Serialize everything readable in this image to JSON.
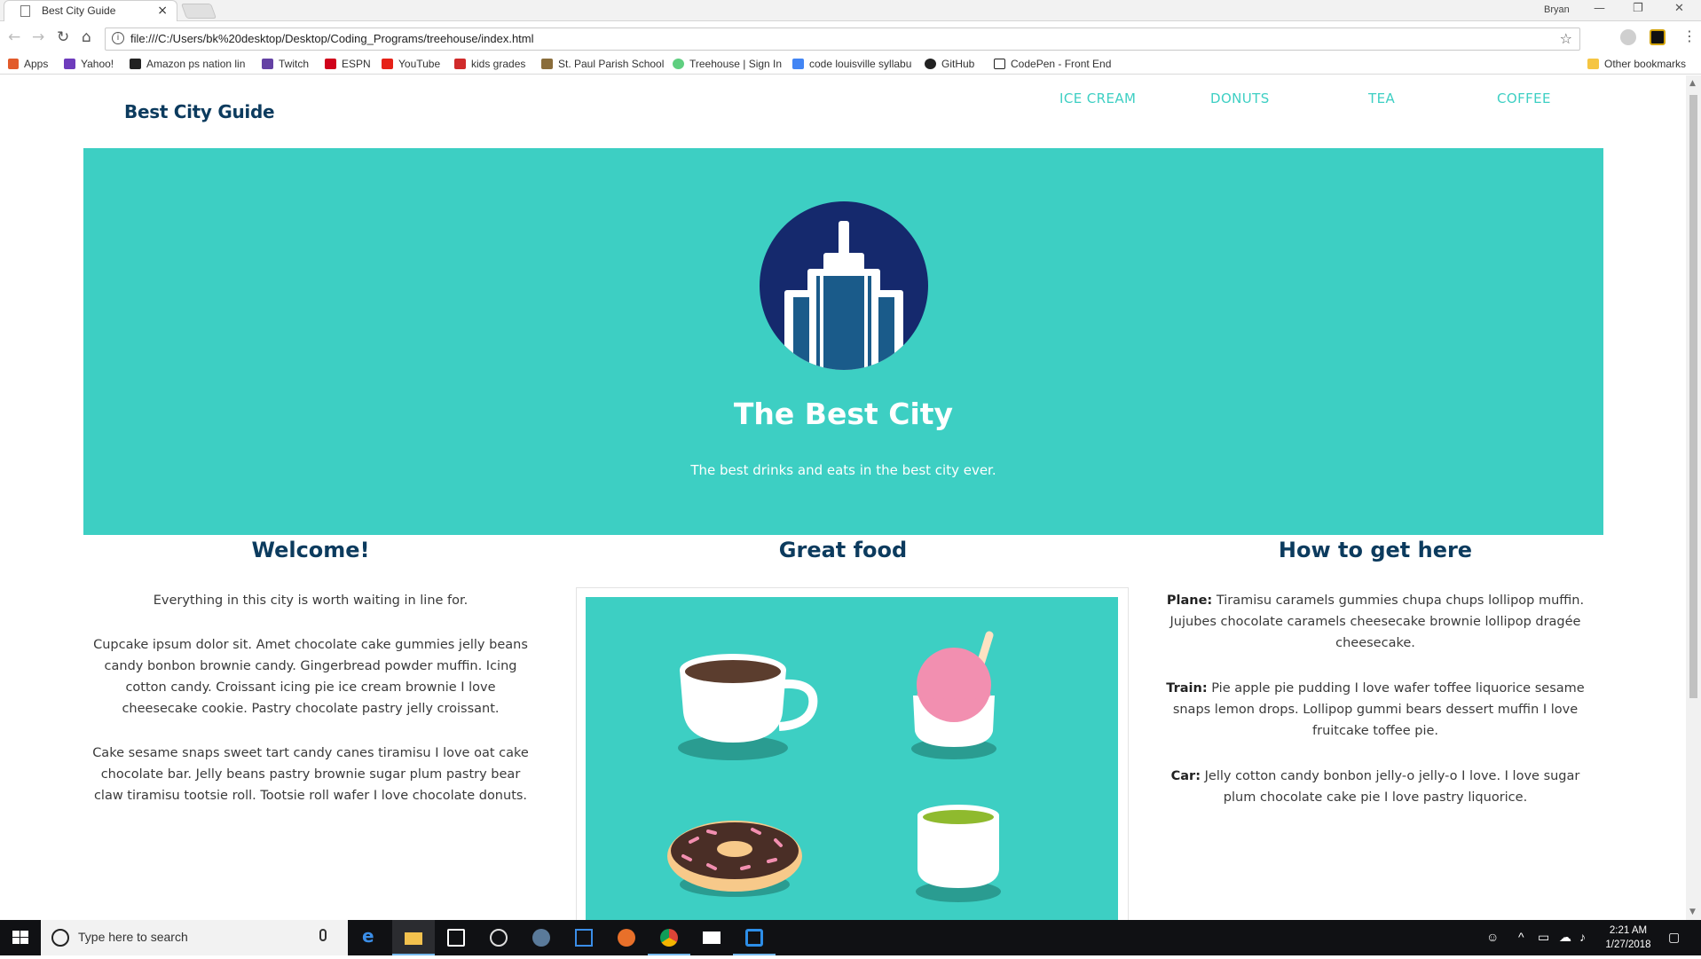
{
  "browser": {
    "tab_title": "Best City Guide",
    "tab_close": "×",
    "user_name": "Bryan",
    "window_controls": {
      "minimize": "—",
      "restore": "❐",
      "close": "✕"
    },
    "url": "file:///C:/Users/bk%20desktop/Desktop/Coding_Programs/treehouse/index.html",
    "bookmarks": [
      {
        "label": "Apps",
        "icon": "apps-grid-icon",
        "color": "#e25b2b"
      },
      {
        "label": "Yahoo!",
        "icon": "yahoo-icon",
        "color": "#6e3cbc"
      },
      {
        "label": "Amazon ps nation lin",
        "icon": "amazon-icon",
        "color": "#222222"
      },
      {
        "label": "Twitch",
        "icon": "twitch-icon",
        "color": "#6441a4"
      },
      {
        "label": "ESPN",
        "icon": "espn-icon",
        "color": "#d0021b"
      },
      {
        "label": "YouTube",
        "icon": "youtube-icon",
        "color": "#e62117"
      },
      {
        "label": "kids grades",
        "icon": "maple-leaf-icon",
        "color": "#d02a2a"
      },
      {
        "label": "St. Paul Parish School",
        "icon": "school-crest-icon",
        "color": "#8a6d3b"
      },
      {
        "label": "Treehouse | Sign In",
        "icon": "treehouse-icon",
        "color": "#5fcf80"
      },
      {
        "label": "code louisville syllabu",
        "icon": "docs-icon",
        "color": "#4285f4"
      },
      {
        "label": "GitHub",
        "icon": "github-icon",
        "color": "#222222"
      },
      {
        "label": "CodePen - Front End",
        "icon": "codepen-icon",
        "color": "#222222"
      }
    ],
    "other_bookmarks": "Other bookmarks"
  },
  "site": {
    "brand": "Best City Guide",
    "nav": [
      "ICE CREAM",
      "DONUTS",
      "TEA",
      "COFFEE"
    ],
    "hero": {
      "title": "The Best City",
      "subtitle": "The best drinks and eats in the best city ever."
    },
    "columns": {
      "welcome": {
        "title": "Welcome!",
        "paragraphs": [
          "Everything in this city is worth waiting in line for.",
          "Cupcake ipsum dolor sit. Amet chocolate cake gummies jelly beans candy bonbon brownie candy. Gingerbread powder muffin. Icing cotton candy. Croissant icing pie ice cream brownie I love cheesecake cookie. Pastry chocolate pastry jelly croissant.",
          "Cake sesame snaps sweet tart candy canes tiramisu I love oat cake chocolate bar. Jelly beans pastry brownie sugar plum pastry bear claw tiramisu tootsie roll. Tootsie roll wafer I love chocolate donuts."
        ]
      },
      "food": {
        "title": "Great food"
      },
      "travel": {
        "title": "How to get here",
        "items": [
          {
            "label": "Plane:",
            "text": "Tiramisu caramels gummies chupa chups lollipop muffin. Jujubes chocolate caramels cheesecake brownie lollipop dragée cheesecake."
          },
          {
            "label": "Train:",
            "text": "Pie apple pie pudding I love wafer toffee liquorice sesame snaps lemon drops. Lollipop gummi bears dessert muffin I love fruitcake toffee pie."
          },
          {
            "label": "Car:",
            "text": "Jelly cotton candy bonbon jelly-o jelly-o I love. I love sugar plum chocolate cake pie I love pastry liquorice."
          }
        ]
      }
    }
  },
  "taskbar": {
    "search_placeholder": "Type here to search",
    "time": "2:21 AM",
    "date": "1/27/2018"
  },
  "colors": {
    "accent_teal": "#3dcfc3",
    "brand_navy": "#0c3b5e",
    "logo_navy": "#15296d"
  }
}
